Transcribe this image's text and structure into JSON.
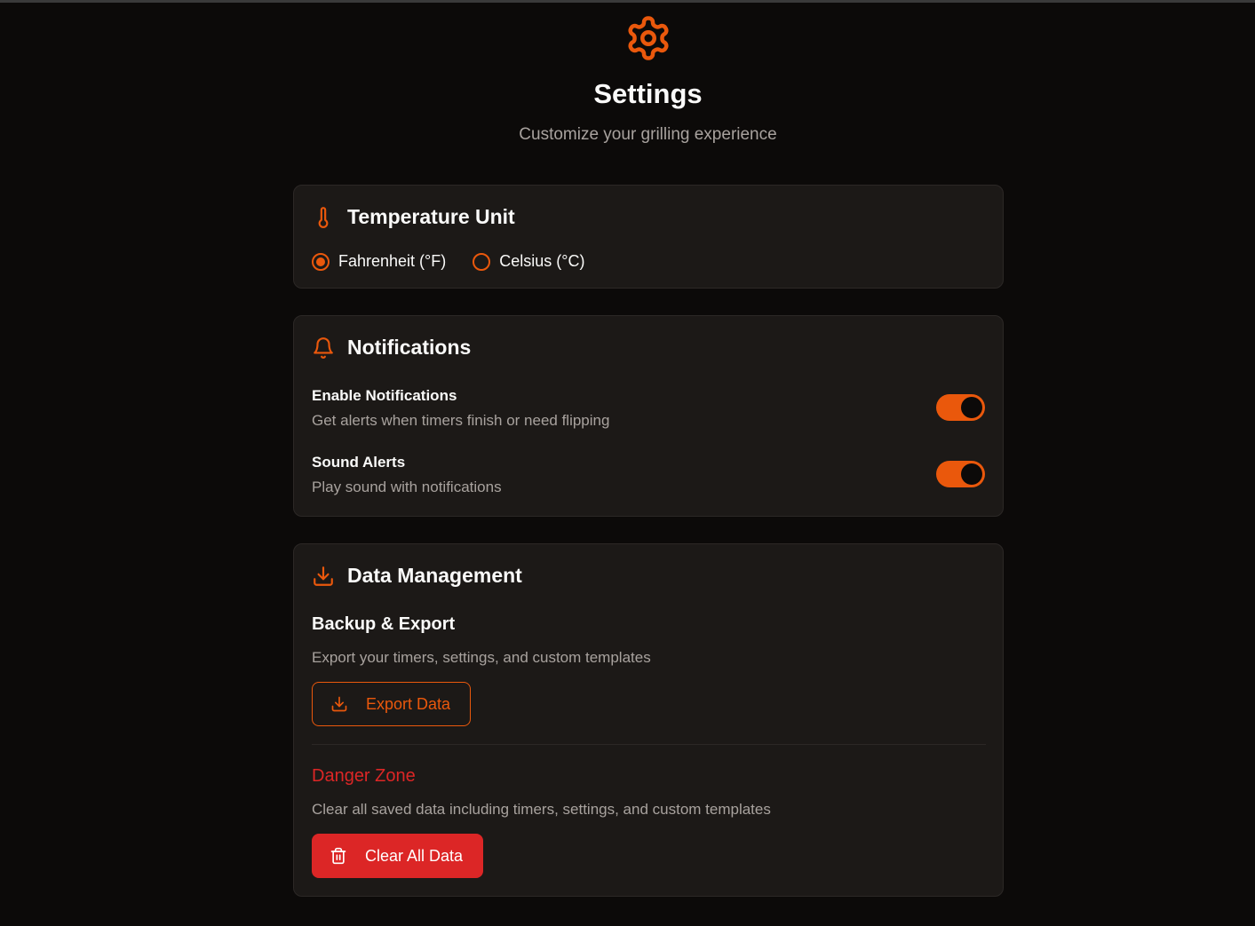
{
  "header": {
    "icon": "gear-icon",
    "title": "Settings",
    "subtitle": "Customize your grilling experience"
  },
  "theme": {
    "accent": "#ea580c",
    "danger": "#dc2626",
    "background": "#0c0a09",
    "card": "#1c1917"
  },
  "temperature": {
    "icon": "thermometer-icon",
    "title": "Temperature Unit",
    "options": [
      {
        "label": "Fahrenheit (°F)",
        "selected": true
      },
      {
        "label": "Celsius (°C)",
        "selected": false
      }
    ]
  },
  "notifications": {
    "icon": "bell-icon",
    "title": "Notifications",
    "items": [
      {
        "name": "Enable Notifications",
        "description": "Get alerts when timers finish or need flipping",
        "enabled": true
      },
      {
        "name": "Sound Alerts",
        "description": "Play sound with notifications",
        "enabled": true
      }
    ]
  },
  "data_management": {
    "icon": "download-icon",
    "title": "Data Management",
    "backup": {
      "title": "Backup & Export",
      "description": "Export your timers, settings, and custom templates",
      "button_label": "Export Data",
      "button_icon": "download-icon"
    },
    "danger": {
      "title": "Danger Zone",
      "description": "Clear all saved data including timers, settings, and custom templates",
      "button_label": "Clear All Data",
      "button_icon": "trash-icon"
    }
  }
}
